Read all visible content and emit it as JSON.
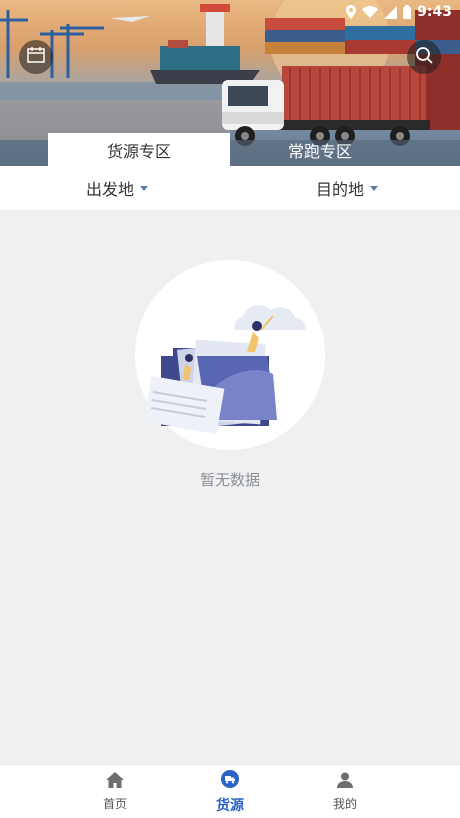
{
  "status_bar": {
    "time": "9:43"
  },
  "tabs": {
    "active": "货源专区",
    "inactive": "常跑专区"
  },
  "filters": {
    "origin": "出发地",
    "destination": "目的地"
  },
  "empty_state": {
    "text": "暂无数据"
  },
  "bottom_nav": {
    "items": [
      {
        "label": "首页",
        "icon": "home-icon"
      },
      {
        "label": "货源",
        "icon": "truck-icon",
        "active": true
      },
      {
        "label": "我的",
        "icon": "user-icon"
      }
    ]
  },
  "colors": {
    "accent": "#2b63c6",
    "caret": "#5b7ea8",
    "illustration": "#4f5aa8"
  }
}
